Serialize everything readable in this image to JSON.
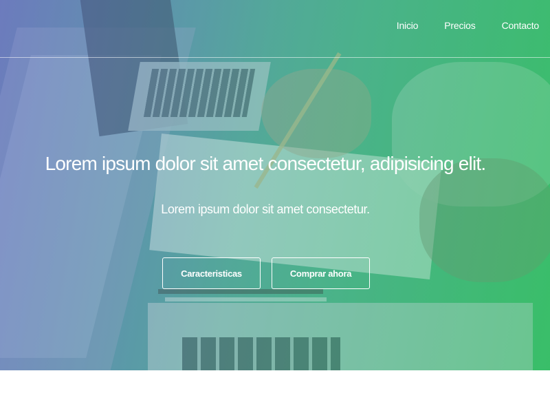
{
  "nav": {
    "items": [
      {
        "label": "Inicio"
      },
      {
        "label": "Precios"
      },
      {
        "label": "Contacto"
      }
    ]
  },
  "hero": {
    "headline": "Lorem ipsum dolor sit amet consectetur, adipisicing elit.",
    "subheadline": "Lorem ipsum dolor sit amet consectetur.",
    "buttons": {
      "features_label": "Caracteristicas",
      "buy_label": "Comprar ahora"
    }
  },
  "colors": {
    "gradient_start": "#6a7fb0",
    "gradient_end": "#42be6e",
    "text": "#ffffff"
  }
}
